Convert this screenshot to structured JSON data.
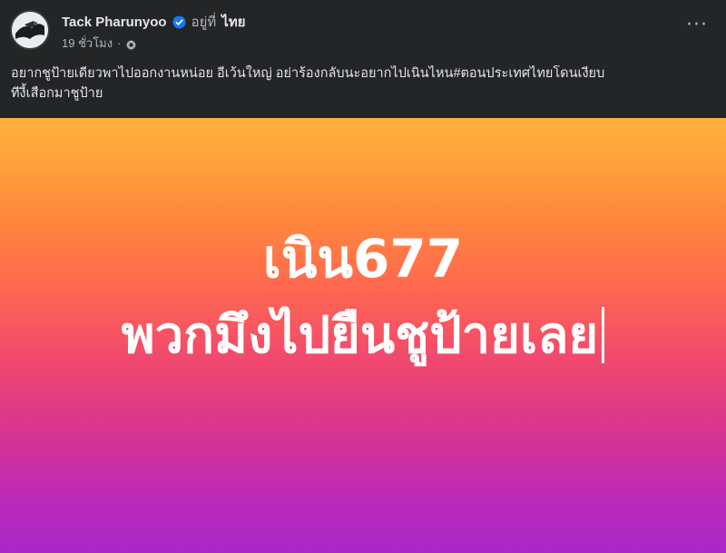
{
  "post": {
    "author": "Tack Pharunyoo",
    "location_prefix": "อยู่ที่",
    "location": "ไทย",
    "timestamp": "19 ชั่วโมง",
    "separator": "·",
    "more_label": "···",
    "caption_line_1": "อยากชูป้ายเดียวพาไปออกงานหน่อย อีเว้นใหญ่  อย่าร้องกลับนะอยากไปเนินไหน#ตอนประเทศไทยโดนเงียบ",
    "caption_line_2": "ทีงี้เสือกมาชูป้าย",
    "card_line_1": "เนิน677",
    "card_line_2": "พวกมึงไปยืนชูป้ายเลย"
  },
  "colors": {
    "background": "#242526",
    "text_primary": "#e4e6eb",
    "text_secondary": "#b0b3b8",
    "verified_blue": "#1877f2",
    "card_gradient_top": "#ffb33a",
    "card_gradient_bottom": "#a928c9"
  },
  "icons": {
    "verified": "verified-badge-icon",
    "audience": "gear-icon",
    "more": "more-horizontal-icon"
  }
}
